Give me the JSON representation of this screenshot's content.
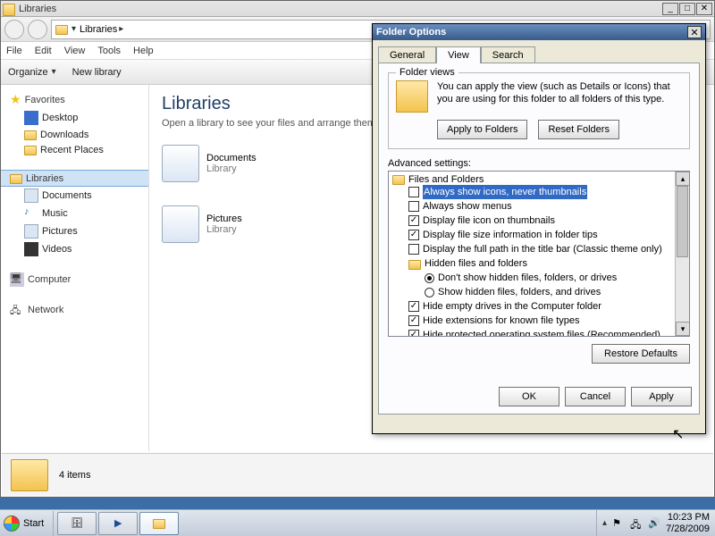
{
  "explorer": {
    "title": "Libraries",
    "breadcrumb": "Libraries",
    "menu": [
      "File",
      "Edit",
      "View",
      "Tools",
      "Help"
    ],
    "toolbar": {
      "organize": "Organize",
      "newlibrary": "New library"
    },
    "nav": {
      "favorites": {
        "label": "Favorites",
        "items": [
          "Desktop",
          "Downloads",
          "Recent Places"
        ]
      },
      "libraries": {
        "label": "Libraries",
        "items": [
          "Documents",
          "Music",
          "Pictures",
          "Videos"
        ]
      },
      "computer": "Computer",
      "network": "Network"
    },
    "content": {
      "heading": "Libraries",
      "sub": "Open a library to see your files and arrange them",
      "items": [
        {
          "name": "Documents",
          "sub": "Library"
        },
        {
          "name": "Pictures",
          "sub": "Library"
        }
      ]
    },
    "status": "4 items"
  },
  "dialog": {
    "title": "Folder Options",
    "tabs": [
      "General",
      "View",
      "Search"
    ],
    "active_tab": "View",
    "folder_views": {
      "legend": "Folder views",
      "text": "You can apply the view (such as Details or Icons) that you are using for this folder to all folders of this type.",
      "apply": "Apply to Folders",
      "reset": "Reset Folders"
    },
    "advanced_label": "Advanced settings:",
    "root": "Files and Folders",
    "settings": [
      {
        "type": "check",
        "checked": false,
        "label": "Always show icons, never thumbnails",
        "selected": true
      },
      {
        "type": "check",
        "checked": false,
        "label": "Always show menus"
      },
      {
        "type": "check",
        "checked": true,
        "label": "Display file icon on thumbnails"
      },
      {
        "type": "check",
        "checked": true,
        "label": "Display file size information in folder tips"
      },
      {
        "type": "check",
        "checked": false,
        "label": "Display the full path in the title bar (Classic theme only)"
      },
      {
        "type": "group",
        "label": "Hidden files and folders",
        "children": [
          {
            "type": "radio",
            "on": true,
            "label": "Don't show hidden files, folders, or drives"
          },
          {
            "type": "radio",
            "on": false,
            "label": "Show hidden files, folders, and drives"
          }
        ]
      },
      {
        "type": "check",
        "checked": true,
        "label": "Hide empty drives in the Computer folder"
      },
      {
        "type": "check",
        "checked": true,
        "label": "Hide extensions for known file types"
      },
      {
        "type": "check",
        "checked": true,
        "label": "Hide protected operating system files (Recommended)"
      }
    ],
    "restore": "Restore Defaults",
    "buttons": {
      "ok": "OK",
      "cancel": "Cancel",
      "apply": "Apply"
    }
  },
  "taskbar": {
    "start": "Start",
    "time": "10:23 PM",
    "date": "7/28/2009"
  }
}
